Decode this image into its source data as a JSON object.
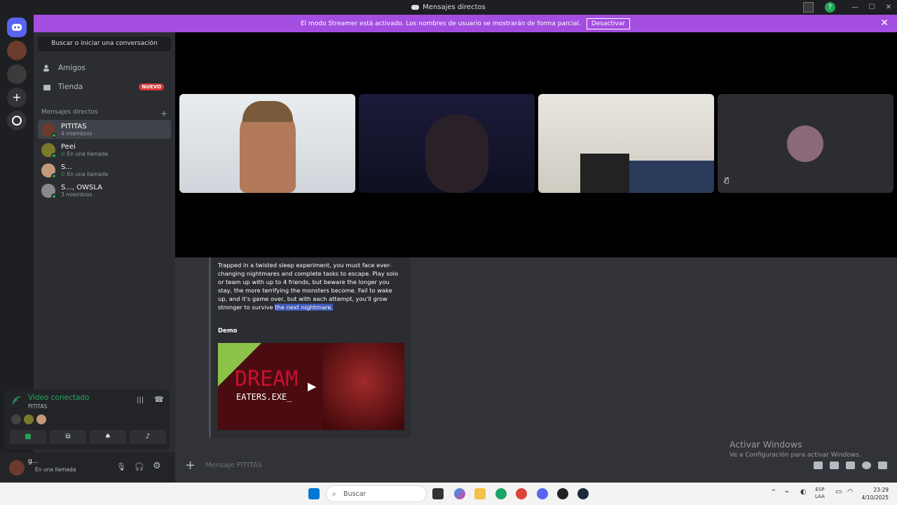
{
  "window": {
    "title": "Mensajes directos",
    "controls": [
      "—",
      "☐",
      "✕"
    ]
  },
  "banner": {
    "text": "El modo Streamer está activado. Los nombres de usuario se mostrarán de forma parcial.",
    "button": "Desactivar",
    "color": "#a34ee0"
  },
  "sidebar": {
    "search": "Buscar o iniciar una conversación",
    "nav": [
      {
        "label": "Amigos",
        "icon": "friends-icon"
      },
      {
        "label": "Tienda",
        "icon": "shop-icon",
        "badge": "NUEVO"
      }
    ],
    "dm_header": "Mensajes directos",
    "dm_add": "+",
    "dms": [
      {
        "name": "PITITAS",
        "sub": "4 miembros"
      },
      {
        "name": "Peei",
        "sub": "En una llamada"
      },
      {
        "name": "S...",
        "sub": "En una llamada"
      },
      {
        "name": "S..., OWSLA",
        "sub": "3 miembros"
      }
    ]
  },
  "voice": {
    "status": "Video conectado",
    "channel": "PITITAS"
  },
  "user": {
    "name": "g...",
    "status": "En una llamada"
  },
  "embed": {
    "desc_main": "Trapped in a twisted sleep experiment, you must face ever-changing nightmares and complete tasks to escape. Play solo or team up with up to 4 friends, but beware the longer you stay, the more terrifying the monsters become. Fail to wake up, and it's game over, but with each attempt, you'll grow stronger to survive",
    "desc_highlight": "the next nightmare.",
    "demo": "Demo",
    "thumb_line1": "DREAM",
    "thumb_line2": "EATERS.EXE_"
  },
  "composer": {
    "placeholder": "Mensaje PITITAS",
    "plus": "+"
  },
  "watermark": {
    "line1": "Activar Windows",
    "line2": "Ve a Configuración para activar Windows."
  },
  "taskbar": {
    "search": "Buscar",
    "lang1": "ESP",
    "lang2": "LAA",
    "time": "23:29",
    "date": "4/10/2025"
  },
  "colors": {
    "accent": "#5865f2",
    "online": "#23a55a",
    "badge": "#da373c"
  }
}
